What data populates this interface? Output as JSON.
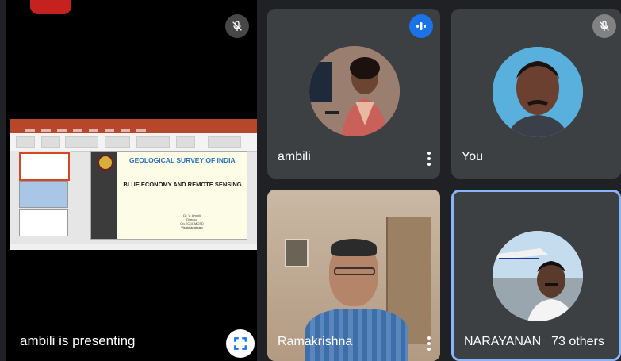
{
  "presentation": {
    "label": "ambili is presenting",
    "slide": {
      "title_org": "GEOLOGICAL SURVEY OF INDIA",
      "title_main": "BLUE ECONOMY AND REMOTE SENSING",
      "presenter_name": "Dr. V. Ambili",
      "presenter_role": "Director",
      "presenter_unit": "Op.EC-II, MCSD",
      "presenter_city": "Visakhapatnam"
    }
  },
  "participants": [
    {
      "name": "ambili"
    },
    {
      "name": "You"
    },
    {
      "name": "Ramakrishna"
    },
    {
      "name": "NARAYANAN"
    }
  ],
  "others": {
    "label": "73 others"
  },
  "colors": {
    "background": "#202124",
    "tile": "#3c4043",
    "active_border": "#8ab4f8",
    "speaking": "#1a73e8",
    "record": "#c5221f"
  }
}
